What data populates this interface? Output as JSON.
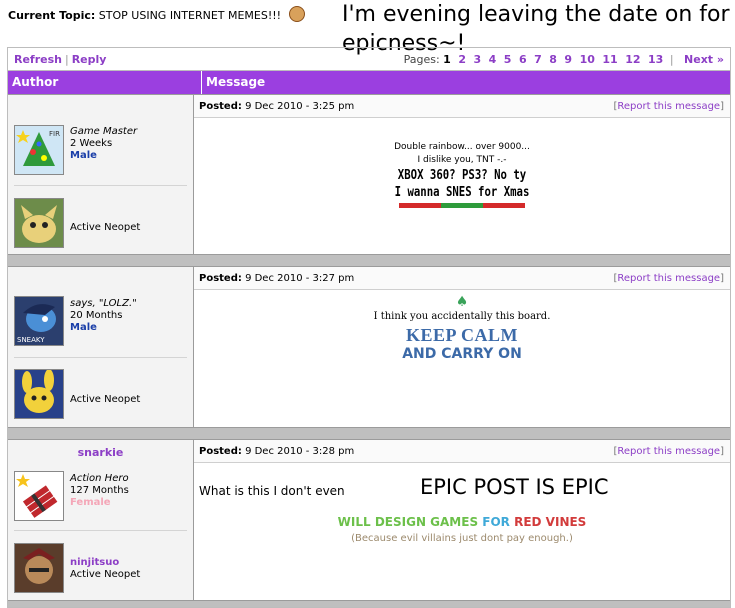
{
  "topic": {
    "label": "Current Topic:",
    "title": "STOP USING INTERNET MEMES!!!"
  },
  "overlay_text": "I'm evening leaving the date on for epicness~!",
  "toolbar": {
    "refresh": "Refresh",
    "reply": "Reply",
    "pages_label": "Pages:",
    "current_page": "1",
    "pages": [
      "2",
      "3",
      "4",
      "5",
      "6",
      "7",
      "8",
      "9",
      "10",
      "11",
      "12",
      "13"
    ],
    "next": "Next »"
  },
  "columns": {
    "author": "Author",
    "message": "Message"
  },
  "posts": [
    {
      "posted_label": "Posted:",
      "posted": "9 Dec 2010 - 3:25 pm",
      "report": "Report this message",
      "user_title": "Game Master",
      "tenure": "2 Weeks",
      "gender": "Male",
      "pet_label": "Active Neopet",
      "sig_lines": [
        "Double rainbow... over 9000...",
        "I dislike you, TNT -.-",
        "XBOX 360? PS3? No ty",
        "I wanna SNES for Xmas"
      ]
    },
    {
      "posted_label": "Posted:",
      "posted": "9 Dec 2010 - 3:27 pm",
      "report": "Report this message",
      "user_title": "says, \"LOLZ.\"",
      "tenure": "20 Months",
      "gender": "Male",
      "pet_label": "Active Neopet",
      "avatar_tag": "SNEAKY",
      "sig_lines": [
        "I think you accidentally this board.",
        "KEEP CALM",
        "AND CARRY ON"
      ]
    },
    {
      "username": "snarkie",
      "posted_label": "Posted:",
      "posted": "9 Dec 2010 - 3:28 pm",
      "report": "Report this message",
      "user_title": "Action Hero",
      "tenure": "127 Months",
      "gender": "Female",
      "pet_name": "ninjitsuo",
      "pet_label": "Active Neopet",
      "message": "What is this I don't even",
      "epic": "EPIC POST IS EPIC",
      "design": {
        "w1": "WILL DESIGN GAMES",
        "w2": "FOR",
        "w3": "RED VINES"
      },
      "caption": "(Because evil villains just dont pay enough.)"
    }
  ],
  "colors": {
    "accent": "#9b3fe0",
    "link": "#8c3ec6",
    "male": "#1a3ea8",
    "female": "#f4a6b7"
  }
}
